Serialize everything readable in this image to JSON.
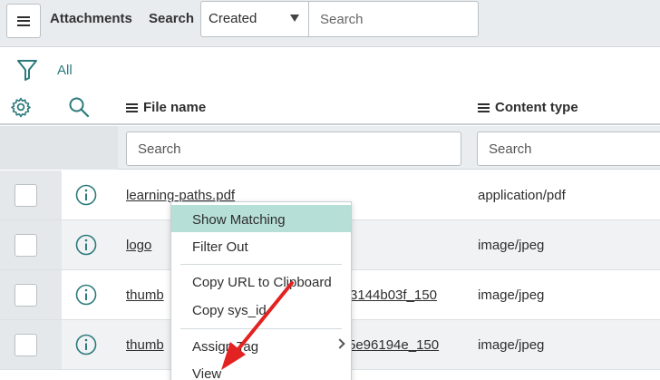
{
  "header": {
    "title": "Attachments",
    "search_label": "Search",
    "select_value": "Created",
    "search_placeholder": "Search"
  },
  "filter": {
    "label": "All"
  },
  "columns": [
    {
      "label": "File name",
      "search_placeholder": "Search"
    },
    {
      "label": "Content type",
      "search_placeholder": "Search"
    }
  ],
  "rows": [
    {
      "file_name": "learning-paths.pdf",
      "file_suffix": "",
      "content_type": "application/pdf"
    },
    {
      "file_name": "logo",
      "file_suffix": "",
      "content_type": "image/jpeg"
    },
    {
      "file_name": "thumb",
      "file_suffix": "3144b03f_150",
      "content_type": "image/jpeg"
    },
    {
      "file_name": "thumb",
      "file_suffix": "5e96194e_150",
      "content_type": "image/jpeg"
    }
  ],
  "context_menu": {
    "items": [
      {
        "label": "Show Matching"
      },
      {
        "label": "Filter Out"
      },
      {
        "label": "Copy URL to Clipboard"
      },
      {
        "label": "Copy sys_id"
      },
      {
        "label": "Assign Tag"
      },
      {
        "label": "View"
      }
    ]
  },
  "colors": {
    "accent": "#2c7a7b",
    "menu_highlight": "#b6dfd7",
    "annotation_arrow": "#e32222",
    "header_bg": "#e8ecee"
  },
  "icons": [
    "hamburger-icon",
    "chevron-down-icon",
    "filter-icon",
    "gear-icon",
    "search-icon",
    "info-icon",
    "chevron-right-icon"
  ]
}
